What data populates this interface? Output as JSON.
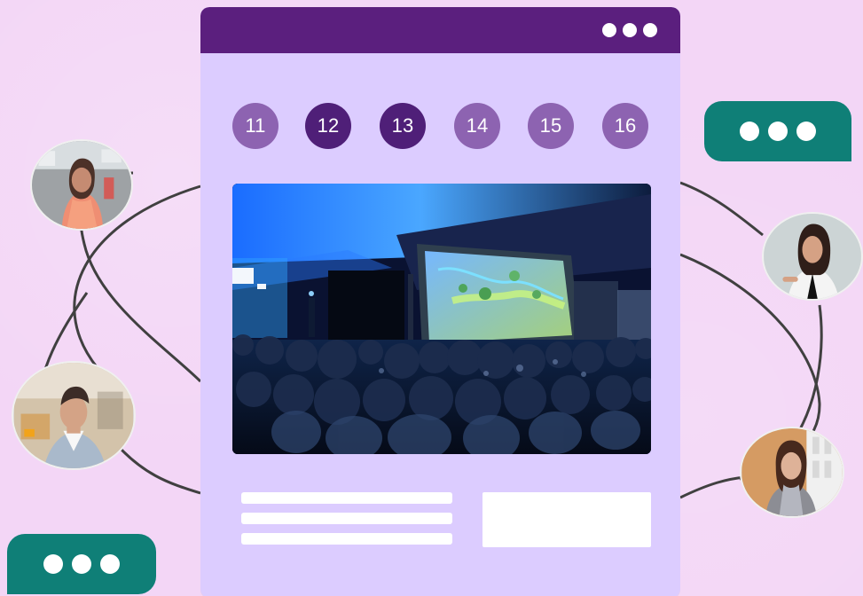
{
  "colors": {
    "background": "#f3d6f6",
    "window": "#dcccff",
    "titlebar": "#5b1f7e",
    "day_dark": "#4f1f78",
    "day_light": "#8d63b1",
    "bubble": "#0f7f77",
    "line": "#404040"
  },
  "window": {
    "titlebar_dots": [
      "dot",
      "dot",
      "dot"
    ],
    "calendar": {
      "days": [
        {
          "label": "11",
          "state": "unselected"
        },
        {
          "label": "12",
          "state": "selected"
        },
        {
          "label": "13",
          "state": "selected"
        },
        {
          "label": "14",
          "state": "unselected"
        },
        {
          "label": "15",
          "state": "unselected"
        },
        {
          "label": "16",
          "state": "unselected"
        }
      ]
    },
    "photo": {
      "subject": "event-photo"
    }
  },
  "chat_bubbles": [
    {
      "name": "chat-bubble-right",
      "dots": 3
    },
    {
      "name": "chat-bubble-left",
      "dots": 3
    }
  ],
  "avatars": [
    {
      "name": "avatar-left-top"
    },
    {
      "name": "avatar-left-bottom"
    },
    {
      "name": "avatar-right-top"
    },
    {
      "name": "avatar-right-bottom"
    }
  ]
}
